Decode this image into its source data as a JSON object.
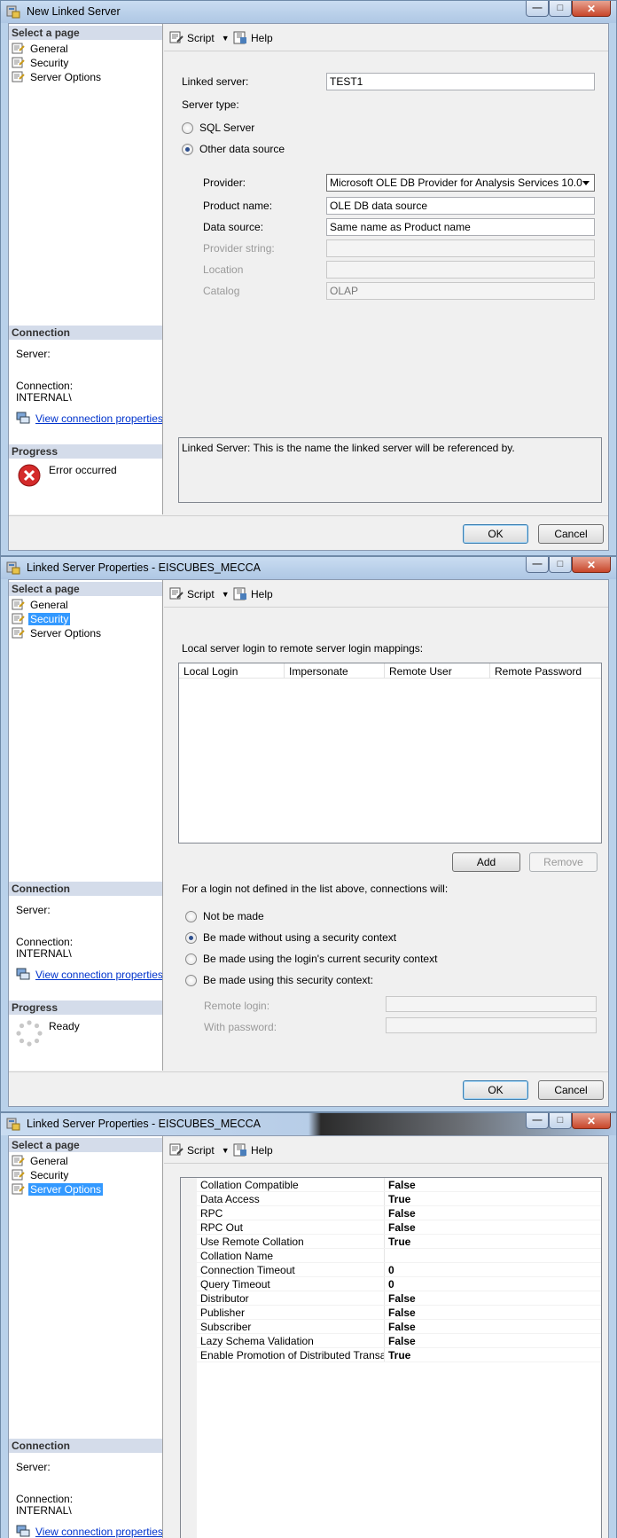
{
  "windows": [
    {
      "title": "New Linked Server",
      "nav_header": "Select a page",
      "nav": [
        "General",
        "Security",
        "Server Options"
      ],
      "selected_nav": -1,
      "connection": {
        "header": "Connection",
        "server_label": "Server:",
        "connection_label": "Connection:",
        "connection_value": "INTERNAL\\",
        "link": "View connection properties"
      },
      "progress": {
        "header": "Progress",
        "status": "Error occurred",
        "icon": "error-icon"
      },
      "toolbar": {
        "script": "Script",
        "help": "Help"
      },
      "general": {
        "linked_server_label": "Linked server:",
        "linked_server_value": "TEST1",
        "server_type_label": "Server type:",
        "sql_server_label": "SQL Server",
        "other_label": "Other data source",
        "provider_label": "Provider:",
        "provider_value": "Microsoft OLE DB Provider for Analysis Services 10.0",
        "product_name_label": "Product name:",
        "product_name_value": "OLE DB data source",
        "data_source_label": "Data source:",
        "data_source_value": "Same name as Product name",
        "provider_string_label": "Provider string:",
        "location_label": "Location",
        "catalog_label": "Catalog",
        "catalog_value": "OLAP",
        "description": "Linked Server: This is the name the linked server will be referenced by."
      },
      "buttons": {
        "ok": "OK",
        "cancel": "Cancel"
      }
    },
    {
      "title": "Linked Server Properties - EISCUBES_MECCA",
      "nav_header": "Select a page",
      "nav": [
        "General",
        "Security",
        "Server Options"
      ],
      "selected_nav": 1,
      "connection": {
        "header": "Connection",
        "server_label": "Server:",
        "connection_label": "Connection:",
        "connection_value": "INTERNAL\\",
        "link": "View connection properties"
      },
      "progress": {
        "header": "Progress",
        "status": "Ready",
        "icon": "spinner-icon"
      },
      "toolbar": {
        "script": "Script",
        "help": "Help"
      },
      "security": {
        "mappings_label": "Local server login to remote server login mappings:",
        "columns": [
          "Local Login",
          "Impersonate",
          "Remote User",
          "Remote Password"
        ],
        "add": "Add",
        "remove": "Remove",
        "not_defined_label": "For a login not defined in the list above, connections will:",
        "options": [
          "Not be made",
          "Be made without using a security context",
          "Be made using the login's current security context",
          "Be made using this security context:"
        ],
        "selected_option": 1,
        "remote_login_label": "Remote login:",
        "with_password_label": "With password:"
      },
      "buttons": {
        "ok": "OK",
        "cancel": "Cancel"
      }
    },
    {
      "title": "Linked Server Properties - EISCUBES_MECCA",
      "nav_header": "Select a page",
      "nav": [
        "General",
        "Security",
        "Server Options"
      ],
      "selected_nav": 2,
      "connection": {
        "header": "Connection",
        "server_label": "Server:",
        "connection_label": "Connection:",
        "connection_value": "INTERNAL\\",
        "link": "View connection properties"
      },
      "toolbar": {
        "script": "Script",
        "help": "Help"
      },
      "server_options": [
        {
          "name": "Collation Compatible",
          "value": "False"
        },
        {
          "name": "Data Access",
          "value": "True"
        },
        {
          "name": "RPC",
          "value": "False"
        },
        {
          "name": "RPC Out",
          "value": "False"
        },
        {
          "name": "Use Remote Collation",
          "value": "True"
        },
        {
          "name": "Collation Name",
          "value": ""
        },
        {
          "name": "Connection Timeout",
          "value": "0"
        },
        {
          "name": "Query Timeout",
          "value": "0"
        },
        {
          "name": "Distributor",
          "value": "False"
        },
        {
          "name": "Publisher",
          "value": "False"
        },
        {
          "name": "Subscriber",
          "value": "False"
        },
        {
          "name": "Lazy Schema Validation",
          "value": "False"
        },
        {
          "name": "Enable Promotion of Distributed Transactions",
          "value": "True"
        }
      ]
    }
  ]
}
